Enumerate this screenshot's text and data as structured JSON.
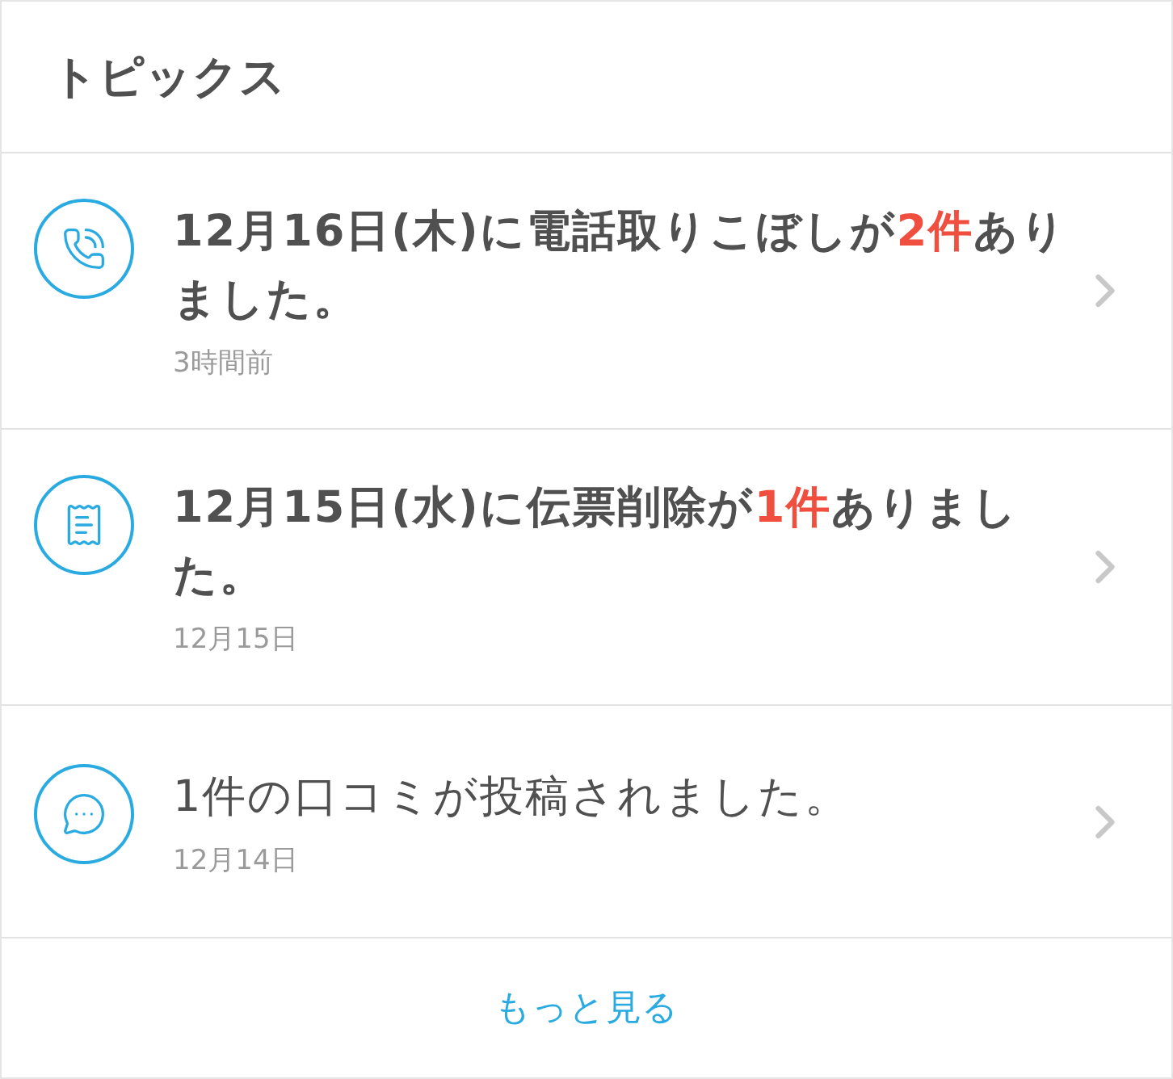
{
  "header": {
    "title": "トピックス"
  },
  "topics": [
    {
      "kind": "phone",
      "unread": true,
      "message": [
        {
          "text": "12月16日(木)に電話取りこぼしが",
          "highlight": false
        },
        {
          "text": "2件",
          "highlight": true
        },
        {
          "text": "ありました。",
          "highlight": false
        }
      ],
      "time": "3時間前"
    },
    {
      "kind": "slip",
      "unread": true,
      "message": [
        {
          "text": "12月15日(水)に伝票削除が",
          "highlight": false
        },
        {
          "text": "1件",
          "highlight": true
        },
        {
          "text": "ありました。",
          "highlight": false
        }
      ],
      "time": "12月15日"
    },
    {
      "kind": "review",
      "unread": false,
      "message": [
        {
          "text": "1件の口コミが投稿されました。",
          "highlight": false
        }
      ],
      "time": "12月14日"
    }
  ],
  "footer": {
    "more_label": "もっと見る"
  }
}
